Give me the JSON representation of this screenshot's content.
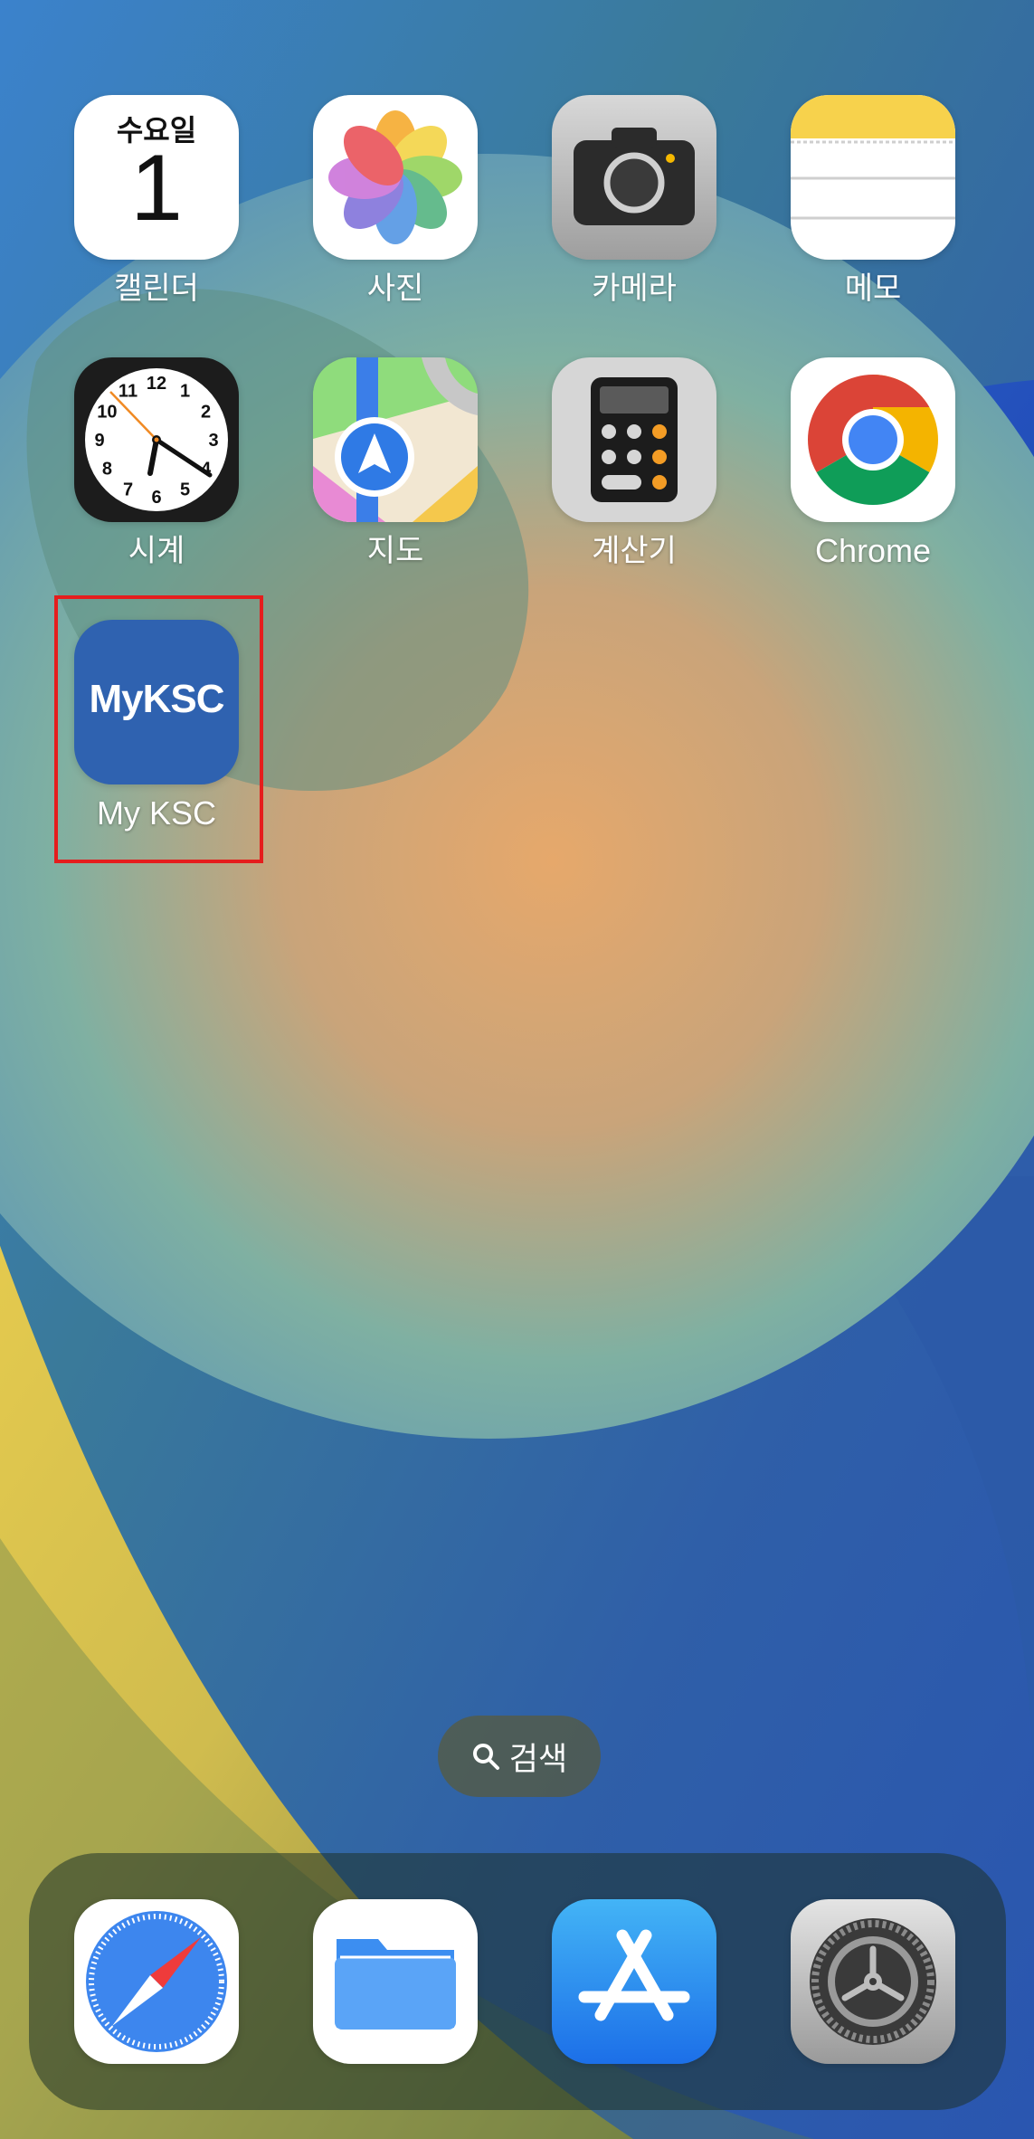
{
  "home_screen": {
    "apps": [
      {
        "id": "calendar",
        "label": "캘린더",
        "weekday": "수요일",
        "day": "1"
      },
      {
        "id": "photos",
        "label": "사진"
      },
      {
        "id": "camera",
        "label": "카메라"
      },
      {
        "id": "notes",
        "label": "메모"
      },
      {
        "id": "clock",
        "label": "시계",
        "numbers": [
          "12",
          "1",
          "2",
          "3",
          "4",
          "5",
          "6",
          "7",
          "8",
          "9",
          "10",
          "11"
        ]
      },
      {
        "id": "maps",
        "label": "지도"
      },
      {
        "id": "calculator",
        "label": "계산기"
      },
      {
        "id": "chrome",
        "label": "Chrome"
      },
      {
        "id": "myksc",
        "label": "My KSC",
        "logo_text": "MyKSC"
      }
    ]
  },
  "search": {
    "label": "검색",
    "icon": "magnifier-icon"
  },
  "dock": {
    "apps": [
      {
        "id": "safari",
        "icon": "compass-icon"
      },
      {
        "id": "files",
        "icon": "folder-icon"
      },
      {
        "id": "app-store",
        "icon": "app-store-icon"
      },
      {
        "id": "settings",
        "icon": "gear-icon"
      }
    ]
  },
  "colors": {
    "highlight": "#e51d1d",
    "myksc_bg": "#2f62b0",
    "chrome_red": "#db4437",
    "chrome_green": "#0f9d58",
    "chrome_yellow": "#f4b400",
    "chrome_blue": "#4285f4"
  }
}
